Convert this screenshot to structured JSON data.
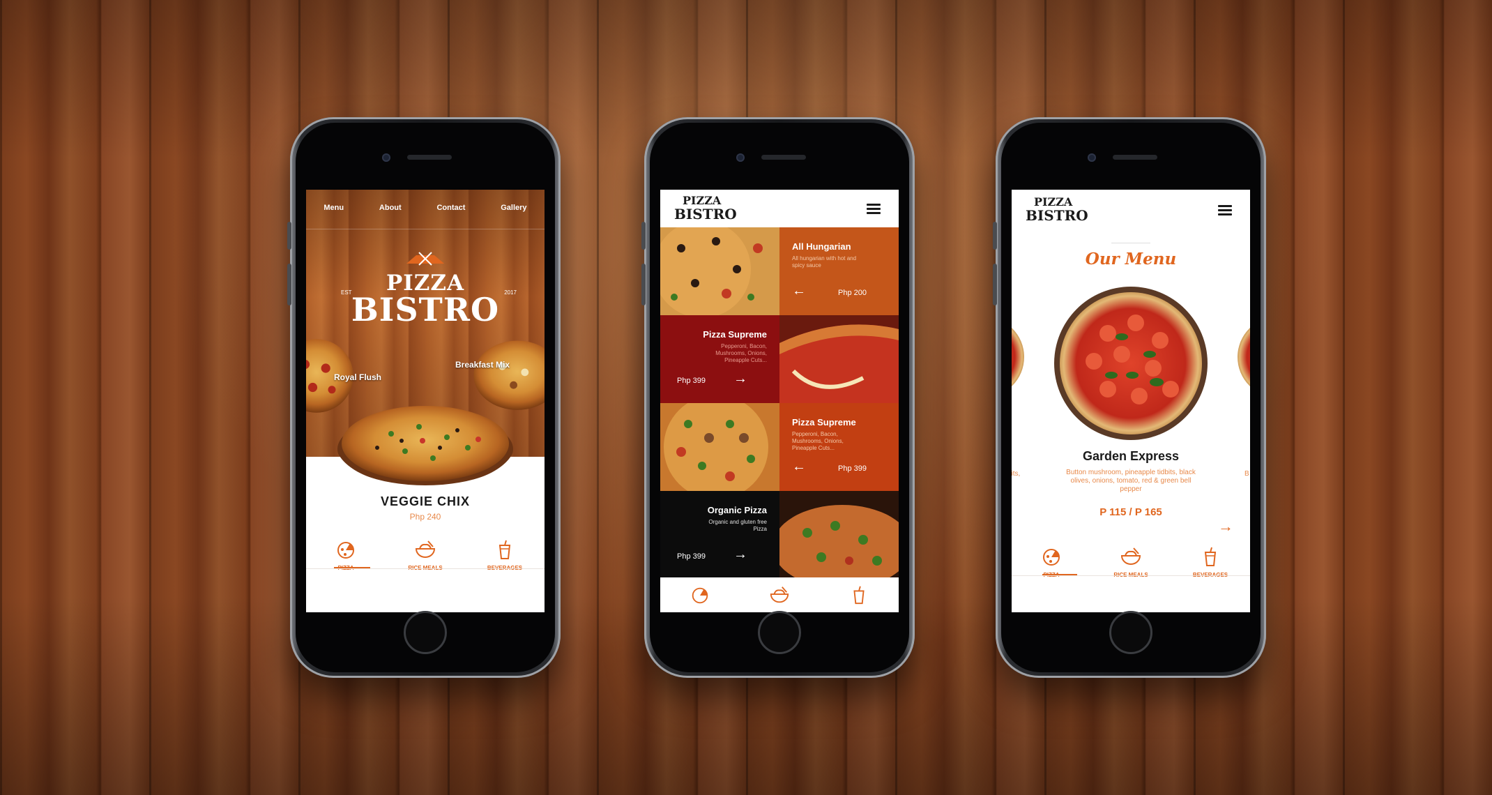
{
  "colors": {
    "accent": "#e0661f",
    "accent_light": "#e8894a",
    "dark": "#1a1a1a",
    "maroon": "#8c0f10",
    "rust": "#c4561a"
  },
  "phone1": {
    "nav": [
      "Menu",
      "About",
      "Contact",
      "Gallery"
    ],
    "logo": {
      "top": "PIZZA",
      "bottom": "BISTRO",
      "est": "EST",
      "year": "2017"
    },
    "side_labels": {
      "left": "Royal Flush",
      "right": "Breakfast Mix"
    },
    "featured": {
      "name": "VEGGIE CHIX",
      "price": "Php 240"
    },
    "tabs": [
      {
        "label": "PIZZA",
        "icon": "pizza-icon"
      },
      {
        "label": "RICE MEALS",
        "icon": "rice-bowl-icon"
      },
      {
        "label": "BEVERAGES",
        "icon": "drink-cup-icon"
      }
    ]
  },
  "phone2": {
    "logo": {
      "top": "PIZZA",
      "bottom": "BISTRO"
    },
    "items": [
      {
        "title": "All Hungarian",
        "desc": "All hungarian with hot and spicy sauce",
        "price": "Php 200"
      },
      {
        "title": "Pizza Supreme",
        "desc": "Pepperoni, Bacon, Mushrooms, Onions, Pineapple Cuts...",
        "price": "Php 399"
      },
      {
        "title": "Pizza Supreme",
        "desc": "Pepperoni, Bacon, Mushrooms, Onions, Pineapple Cuts...",
        "price": "Php 399"
      },
      {
        "title": "Organic Pizza",
        "desc": "Organic and gluten free Pizza",
        "price": "Php 399"
      }
    ]
  },
  "phone3": {
    "logo": {
      "top": "PIZZA",
      "bottom": "BISTRO"
    },
    "heading": "Our Menu",
    "item": {
      "name": "Garden Express",
      "desc": "Button mushroom, pineapple tidbits, black olives, onions, tomato, red & green bell pepper",
      "price": "P 115 / P 165"
    },
    "ghost_left": "bits,",
    "ghost_right": "B",
    "tabs": [
      {
        "label": "PIZZA",
        "icon": "pizza-icon"
      },
      {
        "label": "RICE MEALS",
        "icon": "rice-bowl-icon"
      },
      {
        "label": "BEVERAGES",
        "icon": "drink-cup-icon"
      }
    ]
  }
}
